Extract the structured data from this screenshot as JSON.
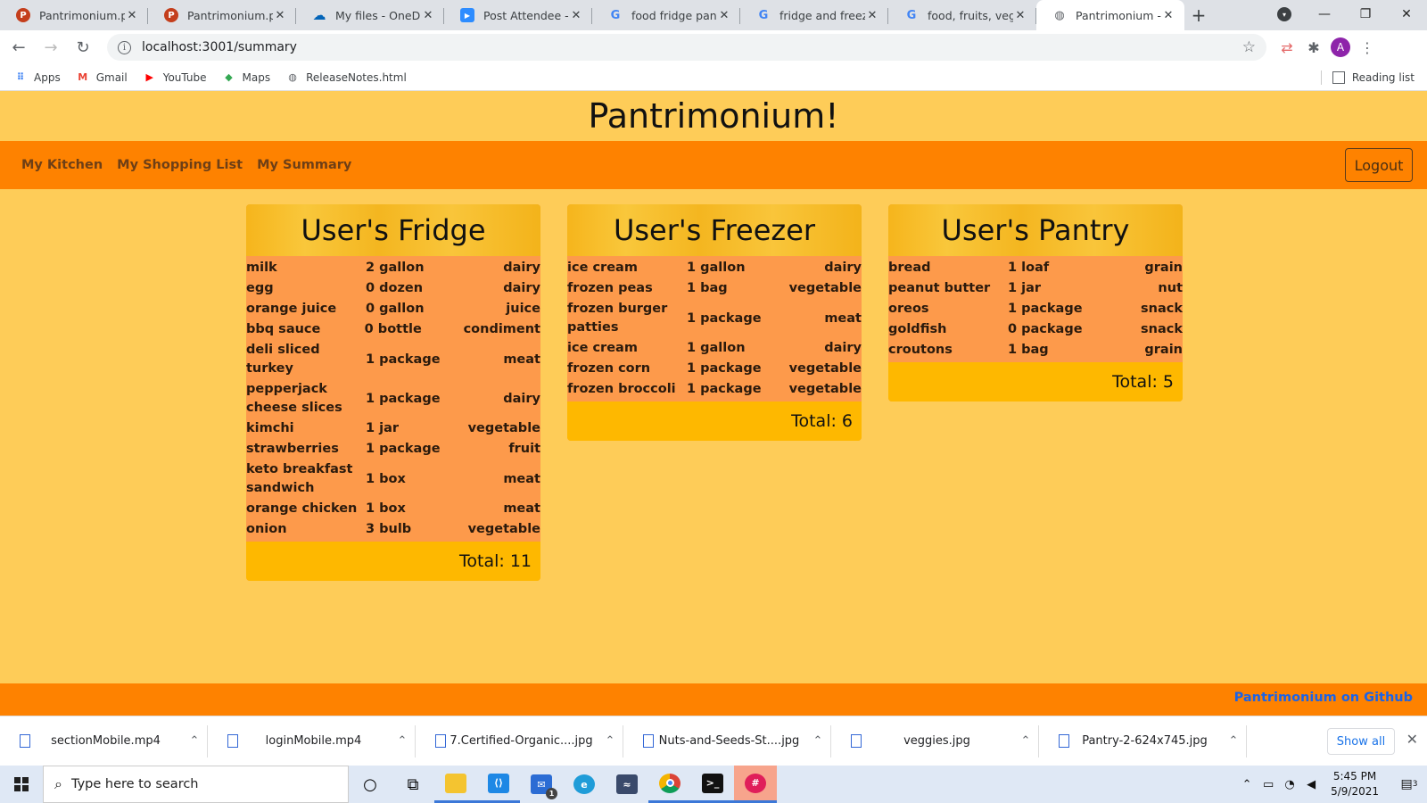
{
  "browser": {
    "tabs": [
      {
        "title": "Pantrimonium.pptx",
        "icon": "powerpoint-icon",
        "color": "#c43e1c"
      },
      {
        "title": "Pantrimonium.pptx",
        "icon": "powerpoint-icon",
        "color": "#c43e1c"
      },
      {
        "title": "My files - OneDrive",
        "icon": "onedrive-icon",
        "color": "#0364b8"
      },
      {
        "title": "Post Attendee - Zoom",
        "icon": "zoom-icon",
        "color": "#2d8cff"
      },
      {
        "title": "food fridge pantry",
        "icon": "google-icon",
        "color": "#4285f4"
      },
      {
        "title": "fridge and freezer s",
        "icon": "google-icon",
        "color": "#4285f4"
      },
      {
        "title": "food, fruits, veggie",
        "icon": "google-icon",
        "color": "#4285f4"
      },
      {
        "title": "Pantrimonium - Ho",
        "icon": "globe-icon",
        "color": "#5f6368"
      }
    ],
    "url": "localhost:3001/summary",
    "avatar_letter": "A",
    "bookmarks": [
      {
        "label": "Apps",
        "icon": "apps-grid-icon"
      },
      {
        "label": "Gmail",
        "icon": "gmail-icon"
      },
      {
        "label": "YouTube",
        "icon": "youtube-icon"
      },
      {
        "label": "Maps",
        "icon": "maps-icon"
      },
      {
        "label": "ReleaseNotes.html",
        "icon": "globe-icon"
      }
    ],
    "reading_list": "Reading list"
  },
  "site": {
    "title": "Pantrimonium!",
    "nav": [
      "My Kitchen",
      "My Shopping List",
      "My Summary"
    ],
    "logout": "Logout",
    "footer_link": "Pantrimonium on Github"
  },
  "cards": {
    "fridge": {
      "title": "User's Fridge",
      "items": [
        [
          "milk",
          "2 gallon",
          "dairy"
        ],
        [
          "egg",
          "0 dozen",
          "dairy"
        ],
        [
          "orange juice",
          "0 gallon",
          "juice"
        ],
        [
          "bbq sauce",
          "0 bottle",
          "condiment"
        ],
        [
          "deli sliced turkey",
          "1 package",
          "meat"
        ],
        [
          "pepperjack cheese slices",
          "1 package",
          "dairy"
        ],
        [
          "kimchi",
          "1 jar",
          "vegetable"
        ],
        [
          "strawberries",
          "1 package",
          "fruit"
        ],
        [
          "keto breakfast sandwich",
          "1 box",
          "meat"
        ],
        [
          "orange chicken",
          "1 box",
          "meat"
        ],
        [
          "onion",
          "3 bulb",
          "vegetable"
        ]
      ],
      "total": "Total: 11"
    },
    "freezer": {
      "title": "User's Freezer",
      "items": [
        [
          "ice cream",
          "1 gallon",
          "dairy"
        ],
        [
          "frozen peas",
          "1 bag",
          "vegetable"
        ],
        [
          "frozen burger patties",
          "1 package",
          "meat"
        ],
        [
          "ice cream",
          "1 gallon",
          "dairy"
        ],
        [
          "frozen corn",
          "1 package",
          "vegetable"
        ],
        [
          "frozen broccoli",
          "1 package",
          "vegetable"
        ]
      ],
      "total": "Total: 6"
    },
    "pantry": {
      "title": "User's Pantry",
      "items": [
        [
          "bread",
          "1 loaf",
          "grain"
        ],
        [
          "peanut butter",
          "1 jar",
          "nut"
        ],
        [
          "oreos",
          "1 package",
          "snack"
        ],
        [
          "goldfish",
          "0 package",
          "snack"
        ],
        [
          "croutons",
          "1 bag",
          "grain"
        ]
      ],
      "total": "Total: 5"
    }
  },
  "downloads": {
    "items": [
      "sectionMobile.mp4",
      "loginMobile.mp4",
      "7.Certified-Organic....jpg",
      "Nuts-and-Seeds-St....jpg",
      "veggies.jpg",
      "Pantry-2-624x745.jpg"
    ],
    "show_all": "Show all"
  },
  "taskbar": {
    "search_placeholder": "Type here to search",
    "time": "5:45 PM",
    "date": "5/9/2021",
    "notification_count": "3",
    "mail_badge": "1"
  },
  "colors": {
    "page_bg": "#fecc58",
    "navbar": "#fe8200",
    "card_body": "#fd9a4b",
    "card_footer": "#feb800",
    "link": "#1a63e8"
  }
}
